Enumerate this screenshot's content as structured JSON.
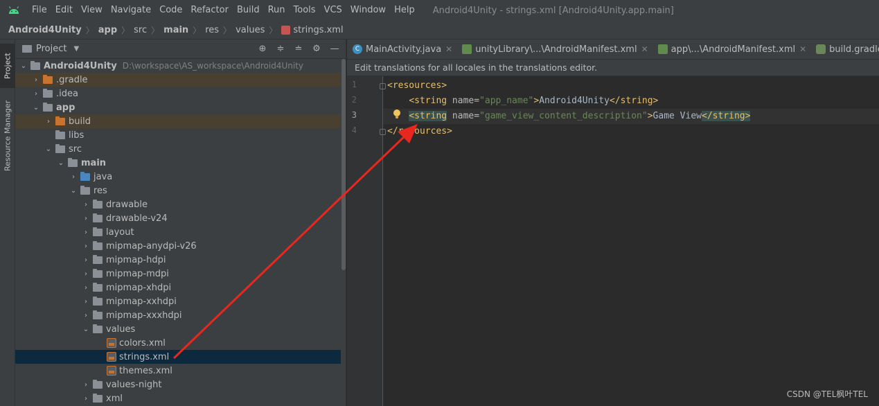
{
  "menubar": {
    "items": [
      "File",
      "Edit",
      "View",
      "Navigate",
      "Code",
      "Refactor",
      "Build",
      "Run",
      "Tools",
      "VCS",
      "Window",
      "Help"
    ],
    "window_title": "Android4Unity - strings.xml [Android4Unity.app.main]"
  },
  "breadcrumb": {
    "items": [
      "Android4Unity",
      "app",
      "src",
      "main",
      "res",
      "values",
      "strings.xml"
    ]
  },
  "leftstripe": {
    "project_tab": "Project",
    "resource_tab": "Resource Manager"
  },
  "project_panel": {
    "title": "Project",
    "tree": [
      {
        "label": "Android4Unity",
        "path": "D:\\workspace\\AS_workspace\\Android4Unity"
      },
      {
        "label": ".gradle"
      },
      {
        "label": ".idea"
      },
      {
        "label": "app"
      },
      {
        "label": "build"
      },
      {
        "label": "libs"
      },
      {
        "label": "src"
      },
      {
        "label": "main"
      },
      {
        "label": "java"
      },
      {
        "label": "res"
      },
      {
        "label": "drawable"
      },
      {
        "label": "drawable-v24"
      },
      {
        "label": "layout"
      },
      {
        "label": "mipmap-anydpi-v26"
      },
      {
        "label": "mipmap-hdpi"
      },
      {
        "label": "mipmap-mdpi"
      },
      {
        "label": "mipmap-xhdpi"
      },
      {
        "label": "mipmap-xxhdpi"
      },
      {
        "label": "mipmap-xxxhdpi"
      },
      {
        "label": "values"
      },
      {
        "label": "colors.xml"
      },
      {
        "label": "strings.xml"
      },
      {
        "label": "themes.xml"
      },
      {
        "label": "values-night"
      },
      {
        "label": "xml"
      }
    ]
  },
  "tabs": [
    {
      "label": "MainActivity.java"
    },
    {
      "label": "unityLibrary\\...\\AndroidManifest.xml"
    },
    {
      "label": "app\\...\\AndroidManifest.xml"
    },
    {
      "label": "build.gradle (:app)"
    }
  ],
  "banner": "Edit translations for all locales in the translations editor.",
  "editor": {
    "line_numbers": [
      "1",
      "2",
      "3",
      "4"
    ],
    "line1": "<resources>",
    "line2": {
      "indent": "    ",
      "open": "<string",
      "attr": " name=",
      "value": "\"app_name\"",
      "gt": ">",
      "text": "Android4Unity",
      "close": "</string>"
    },
    "line3": {
      "indent": "    ",
      "open": "<string",
      "attr": " name=",
      "value": "\"game_view_content_description\"",
      "gt": ">",
      "text": "Game View",
      "close": "</string>"
    },
    "line4": "</resources>"
  },
  "watermark": "CSDN @TEL枫叶TEL",
  "colors": {
    "arrow": "#e8281e",
    "tag": "#e8bf6a",
    "attr_value": "#6a8759",
    "selection": "#0d293e"
  }
}
